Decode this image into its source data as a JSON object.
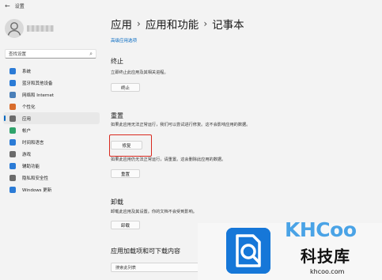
{
  "window": {
    "title": "设置"
  },
  "sidebar": {
    "search_placeholder": "查找设置",
    "items": [
      {
        "label": "系统",
        "icon": "monitor-icon",
        "color": "#2b7bd6"
      },
      {
        "label": "蓝牙和其他设备",
        "icon": "bluetooth-icon",
        "color": "#2b7bd6"
      },
      {
        "label": "网络和 Internet",
        "icon": "network-icon",
        "color": "#4a7fb8"
      },
      {
        "label": "个性化",
        "icon": "brush-icon",
        "color": "#d86c2c"
      },
      {
        "label": "应用",
        "icon": "apps-icon",
        "color": "#6b6b6b",
        "active": true
      },
      {
        "label": "帐户",
        "icon": "person-icon",
        "color": "#2fa36b"
      },
      {
        "label": "时间和语言",
        "icon": "globe-clock-icon",
        "color": "#2b7bd6"
      },
      {
        "label": "游戏",
        "icon": "gamepad-icon",
        "color": "#6b6b6b"
      },
      {
        "label": "辅助功能",
        "icon": "accessibility-icon",
        "color": "#2b7bd6"
      },
      {
        "label": "隐私和安全性",
        "icon": "shield-icon",
        "color": "#6b6b6b"
      },
      {
        "label": "Windows 更新",
        "icon": "update-icon",
        "color": "#2b7bd6"
      }
    ]
  },
  "main": {
    "breadcrumb": [
      "应用",
      "应用和功能",
      "记事本"
    ],
    "breadcrumb_sep": "›",
    "advanced_link": "高级应用选项",
    "terminate": {
      "title": "终止",
      "desc": "立即终止此应用及其相关进程。",
      "button": "终止"
    },
    "reset": {
      "title": "重置",
      "repair_desc": "如果此应用无法正常运行，我们可以尝试进行修复。这不会影响应用的数据。",
      "repair_button": "修复",
      "reset_desc": "如果此应用仍无法正常运行，请重置。这会删除此应用的数据。",
      "reset_button": "重置"
    },
    "uninstall": {
      "title": "卸载",
      "desc": "卸载此应用及其设置。你的文档不会受到影响。",
      "button": "卸载"
    },
    "addons": {
      "title": "应用加载项和可下载内容",
      "search_placeholder": "搜索此列表"
    }
  },
  "watermark": {
    "brand": "KHCoo",
    "cn": "科技库",
    "url": "khcoo.com",
    "color": "#1677d8"
  }
}
